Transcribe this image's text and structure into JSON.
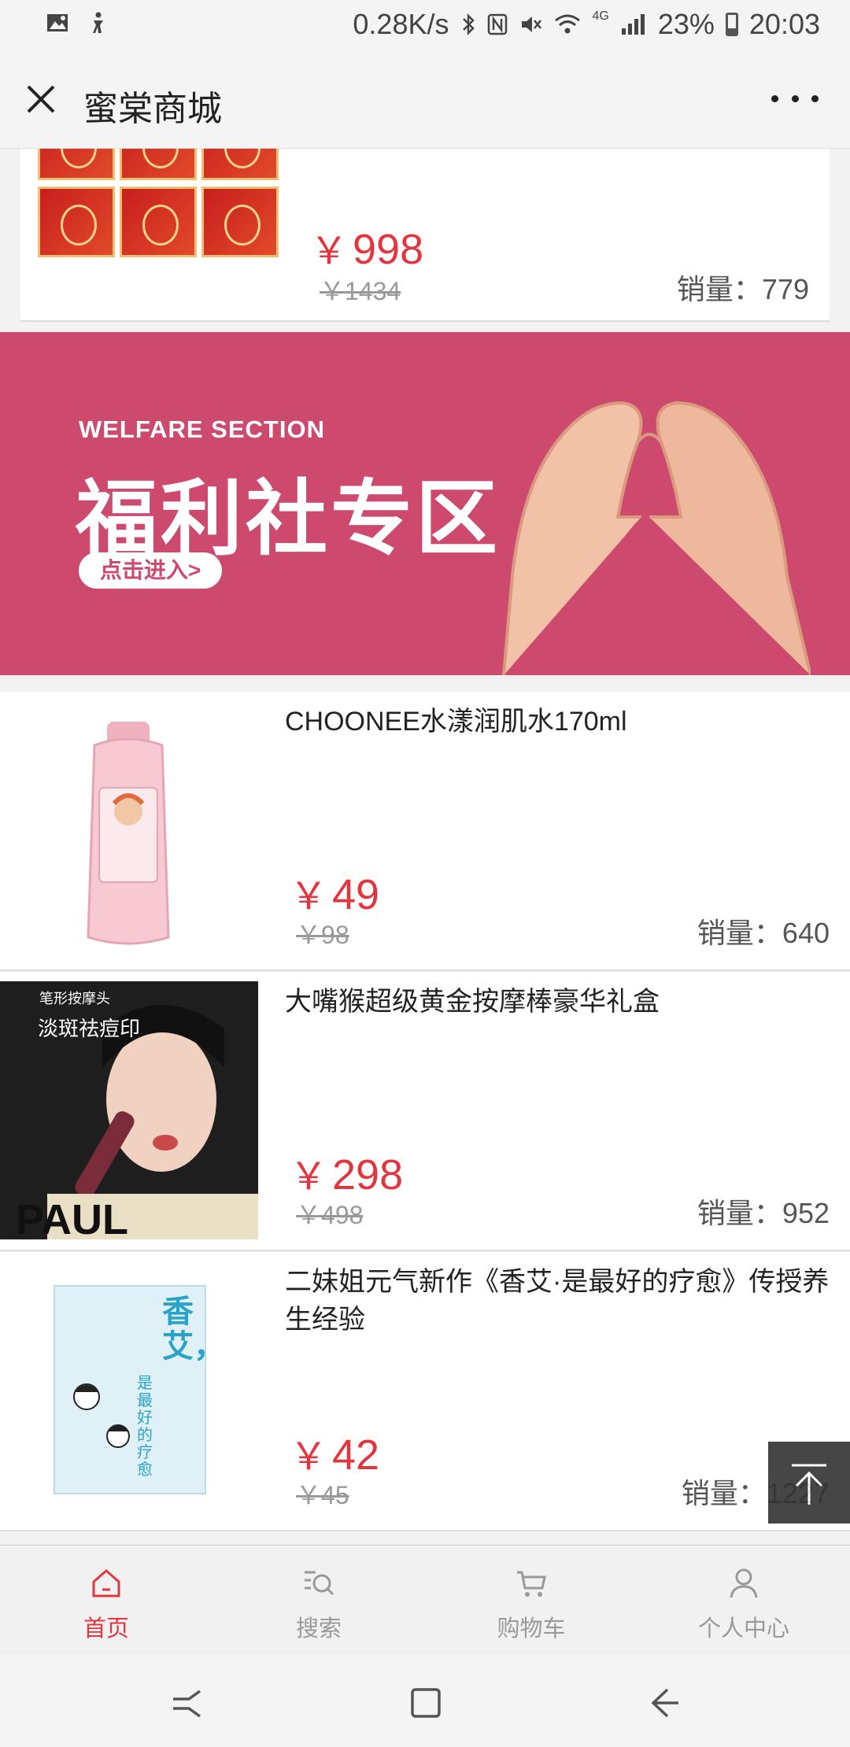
{
  "status_bar": {
    "speed": "0.28K/s",
    "battery": "23%",
    "time": "20:03",
    "network": "4G"
  },
  "title_bar": {
    "title": "蜜棠商城"
  },
  "products_top": {
    "price": "998",
    "orig_price": "1434",
    "sales": "销量：779"
  },
  "banner": {
    "en_title": "WELFARE SECTION",
    "cn_title": "福利社专区",
    "button": "点击进入>"
  },
  "currency": "￥",
  "products": [
    {
      "name": "CHOONEE水漾润肌水170ml",
      "price": "49",
      "orig_price": "98",
      "sales": "销量：640"
    },
    {
      "name": "大嘴猴超级黄金按摩棒豪华礼盒",
      "price": "298",
      "orig_price": "498",
      "sales": "销量：952",
      "image_text_1": "笔形按摩头",
      "image_text_2": "淡斑祛痘印",
      "image_text_3": "PAUL FRANK"
    },
    {
      "name": "二妹姐元气新作《香艾·是最好的疗愈》传授养生经验",
      "price": "42",
      "orig_price": "45",
      "sales": "销量：1227",
      "image_text_1": "香艾，",
      "image_text_2": "是最好的疗愈"
    }
  ],
  "bottom_nav": [
    {
      "label": "首页",
      "icon": "home-icon",
      "active": true
    },
    {
      "label": "搜索",
      "icon": "search-icon",
      "active": false
    },
    {
      "label": "购物车",
      "icon": "cart-icon",
      "active": false
    },
    {
      "label": "个人中心",
      "icon": "user-icon",
      "active": false
    }
  ],
  "colors": {
    "accent": "#e2353e",
    "banner_bg": "#cd4a6e"
  }
}
